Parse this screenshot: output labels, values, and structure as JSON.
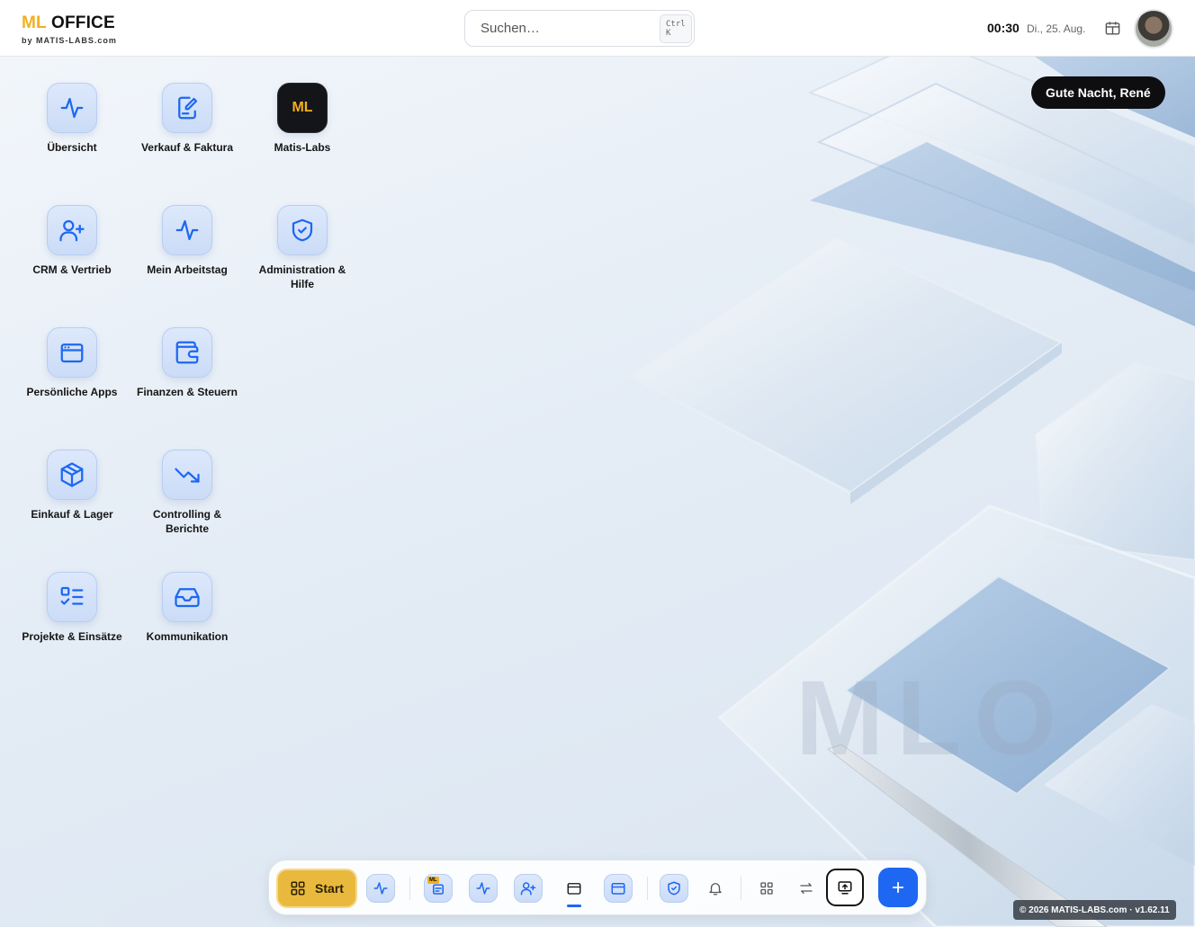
{
  "header": {
    "brand_ml": "ML",
    "brand_office": "OFFICE",
    "brand_sub": "by MATIS-LABS.com",
    "search_placeholder": "Suchen…",
    "search_shortcut": "Ctrl K",
    "time": "00:30",
    "date": "Di., 25. Aug."
  },
  "greeting": "Gute Nacht, René",
  "watermark": "MLO",
  "apps": [
    {
      "label": "Übersicht",
      "icon": "activity-icon"
    },
    {
      "label": "Verkauf & Faktura",
      "icon": "edit-document-icon"
    },
    {
      "label": "Matis-Labs",
      "icon": "ml-logo",
      "logo_text": "ML"
    },
    {
      "label": "CRM & Vertrieb",
      "icon": "user-plus-icon"
    },
    {
      "label": "Mein Arbeitstag",
      "icon": "activity-icon"
    },
    {
      "label": "Administration & Hilfe",
      "icon": "shield-check-icon"
    },
    {
      "label": "Persönliche Apps",
      "icon": "browser-window-icon"
    },
    {
      "label": "Finanzen & Steuern",
      "icon": "wallet-icon"
    },
    {
      "label": "Einkauf & Lager",
      "icon": "package-icon"
    },
    {
      "label": "Controlling & Berichte",
      "icon": "trending-down-icon"
    },
    {
      "label": "Projekte & Einsätze",
      "icon": "checklist-icon"
    },
    {
      "label": "Kommunikation",
      "icon": "inbox-icon"
    }
  ],
  "dock": {
    "start_label": "Start",
    "ml_badge": "ML",
    "items": [
      "activity-icon",
      "ml-app-icon",
      "activity-icon",
      "user-plus-icon",
      "browser-window-icon",
      "browser-window-icon",
      "shield-check-icon",
      "bell-icon",
      "grid-icon",
      "swap-icon",
      "screen-share-icon",
      "plus-icon"
    ]
  },
  "footer": "© 2026 MATIS-LABS.com · v1.62.11",
  "colors": {
    "accent": "#1d67f2",
    "brand_yellow": "#f2b01e",
    "tile_bg": "#d6e3f9"
  }
}
